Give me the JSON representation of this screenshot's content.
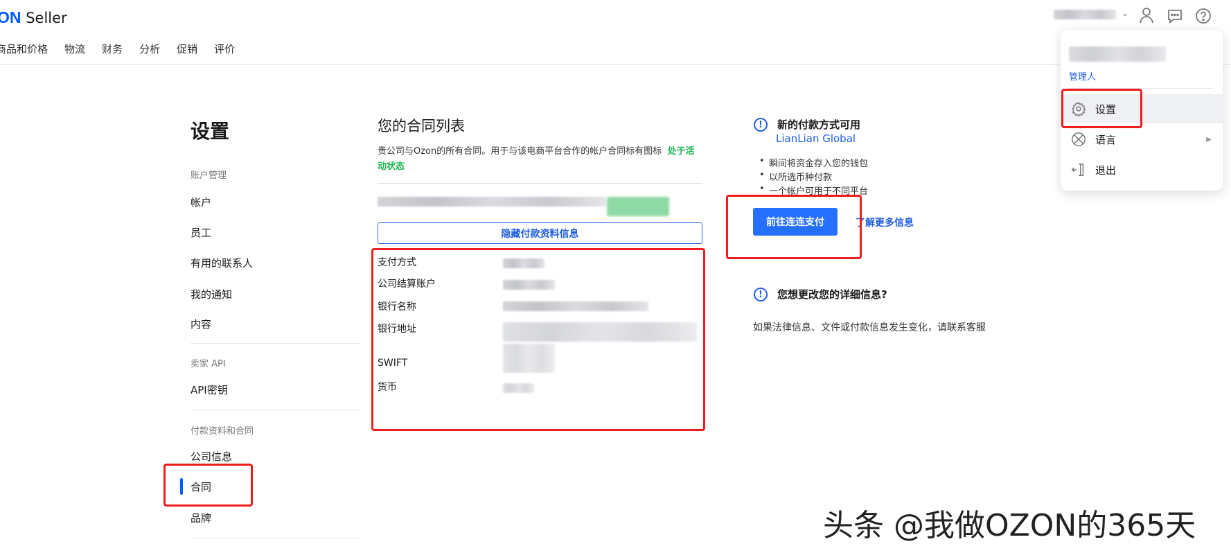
{
  "header": {
    "logo_text": "ON",
    "brand": "Seller",
    "nav": [
      "商品和价格",
      "物流",
      "财务",
      "分析",
      "促销",
      "评价"
    ]
  },
  "sidebar": {
    "title": "设置",
    "sections": [
      {
        "label": "账户管理",
        "items": [
          "帐户",
          "员工",
          "有用的联系人",
          "我的通知",
          "内容"
        ]
      },
      {
        "label": "卖家 API",
        "items": [
          "API密钥"
        ]
      },
      {
        "label": "付款资料和合同",
        "items": [
          "公司信息",
          "合同",
          "品牌"
        ]
      }
    ]
  },
  "main": {
    "title": "您的合同列表",
    "description": "贵公司与Ozon的所有合同。用于与该电商平台合作的帐户合同标有图标",
    "status_active": "处于活动状态",
    "hide_button": "隐藏付款资料信息",
    "fields": [
      "支付方式",
      "公司结算账户",
      "银行名称",
      "银行地址",
      "SWIFT",
      "货币"
    ]
  },
  "right": {
    "promo_title": "新的付款方式可用",
    "promo_brand": "LianLian Global",
    "bullets": [
      "瞬间将资金存入您的钱包",
      "以所选币种付款",
      "一个帐户可用于不同平台"
    ],
    "go_button": "前往连连支付",
    "learn_more": "了解更多信息",
    "change_title": "您想更改您的详细信息?",
    "change_text": "如果法律信息、文件或付款信息发生变化，请联系客服"
  },
  "dropdown": {
    "role": "管理人",
    "items": [
      "设置",
      "语言",
      "退出"
    ]
  },
  "watermark": "头条 @我做OZON的365天",
  "colors": {
    "accent": "#005bff",
    "active": "#1fb354",
    "highlight": "#ee1c1c"
  }
}
